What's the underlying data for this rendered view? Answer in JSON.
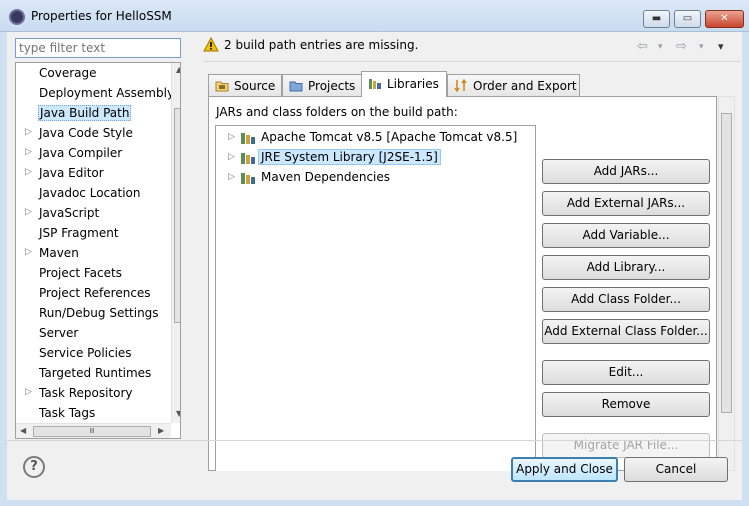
{
  "window": {
    "title": "Properties for HelloSSM",
    "min": "▬",
    "max": "▭",
    "close": "✕"
  },
  "filter": {
    "placeholder": "type filter text"
  },
  "nav": {
    "items": [
      {
        "label": "Coverage",
        "arrow": ""
      },
      {
        "label": "Deployment Assembly",
        "arrow": ""
      },
      {
        "label": "Java Build Path",
        "arrow": "",
        "selected": true
      },
      {
        "label": "Java Code Style",
        "arrow": "▷"
      },
      {
        "label": "Java Compiler",
        "arrow": "▷"
      },
      {
        "label": "Java Editor",
        "arrow": "▷"
      },
      {
        "label": "Javadoc Location",
        "arrow": ""
      },
      {
        "label": "JavaScript",
        "arrow": "▷"
      },
      {
        "label": "JSP Fragment",
        "arrow": ""
      },
      {
        "label": "Maven",
        "arrow": "▷"
      },
      {
        "label": "Project Facets",
        "arrow": ""
      },
      {
        "label": "Project References",
        "arrow": ""
      },
      {
        "label": "Run/Debug Settings",
        "arrow": ""
      },
      {
        "label": "Server",
        "arrow": ""
      },
      {
        "label": "Service Policies",
        "arrow": ""
      },
      {
        "label": "Targeted Runtimes",
        "arrow": ""
      },
      {
        "label": "Task Repository",
        "arrow": "▷"
      },
      {
        "label": "Task Tags",
        "arrow": ""
      }
    ]
  },
  "message": {
    "text": "2 build path entries are missing.",
    "icon": "warning-icon",
    "back": "⇦",
    "forward": "⇨",
    "dropdown": "▾"
  },
  "tabs": [
    {
      "label": "Source"
    },
    {
      "label": "Projects"
    },
    {
      "label": "Libraries",
      "active": true
    },
    {
      "label": "Order and Export"
    }
  ],
  "libraries": {
    "caption": "JARs and class folders on the build path:",
    "entries": [
      {
        "label": "Apache Tomcat v8.5 [Apache Tomcat v8.5]"
      },
      {
        "label": "JRE System Library [J2SE-1.5]",
        "selected": true
      },
      {
        "label": "Maven Dependencies"
      }
    ],
    "buttons": {
      "add_jars": "Add JARs...",
      "add_external_jars": "Add External JARs...",
      "add_variable": "Add Variable...",
      "add_library": "Add Library...",
      "add_class_folder": "Add Class Folder...",
      "add_external_class_folder": "Add External Class Folder...",
      "edit": "Edit...",
      "remove": "Remove",
      "migrate_jar": "Migrate JAR File..."
    }
  },
  "footer": {
    "help": "?",
    "apply_close": "Apply and Close",
    "cancel": "Cancel"
  },
  "colors": {
    "selection": "#cce8ff",
    "default_button": "#3c7fb1",
    "warning": "#f2c200"
  }
}
